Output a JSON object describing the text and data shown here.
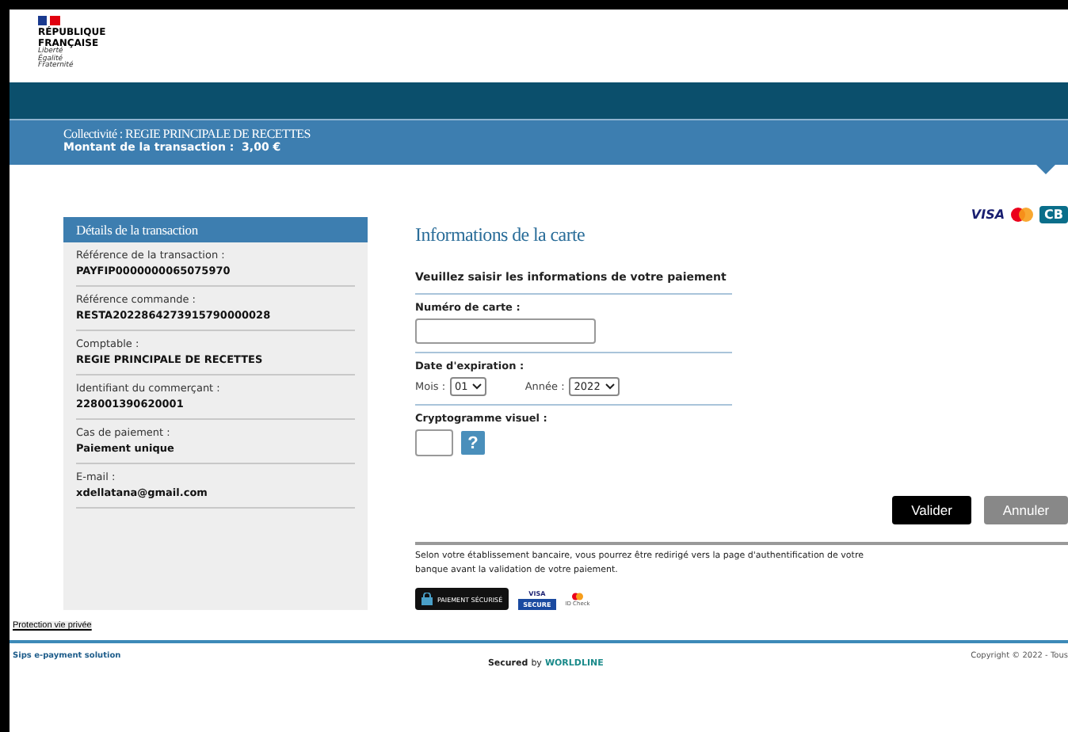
{
  "header": {
    "logo_lines": [
      "RÉPUBLIQUE",
      "FRANÇAISE"
    ],
    "motto": [
      "Liberté",
      "Égalité",
      "Fraternité"
    ]
  },
  "banner": {
    "collectivite": "Collectivité : REGIE PRINCIPALE DE RECETTES",
    "montant_label": "Montant de la transaction :",
    "montant": "3,00 €"
  },
  "details": {
    "title": "Détails de la transaction",
    "items": [
      {
        "label": "Référence de la transaction :",
        "value": "PAYFIP0000000065075970"
      },
      {
        "label": "Référence commande :",
        "value": "RESTA2022864273915790000028"
      },
      {
        "label": "Comptable :",
        "value": "REGIE PRINCIPALE DE RECETTES"
      },
      {
        "label": "Identifiant du commerçant :",
        "value": "228001390620001"
      },
      {
        "label": "Cas de paiement :",
        "value": "Paiement unique"
      },
      {
        "label": "E-mail :",
        "value": "xdellatana@gmail.com"
      }
    ]
  },
  "card_form": {
    "title": "Informations de la carte",
    "card_brands": [
      "VISA",
      "CB"
    ],
    "instruction": "Veuillez saisir les informations de votre paiement",
    "card_number_label": "Numéro de carte :",
    "expiry_label": "Date d'expiration :",
    "month_label": "Mois :",
    "month": "01",
    "year_label": "Année :",
    "year": "2022",
    "cvv_label": "Cryptogramme visuel :",
    "help_button": "?"
  },
  "buttons": [
    {
      "label": "Valider",
      "kind": "primary"
    },
    {
      "label": "Annuler",
      "kind": "secondary"
    }
  ],
  "notice": "Selon votre établissement bancaire, vous pourrez être redirigé vers la page d'authentification de votre banque avant la validation de votre paiement.",
  "badges": {
    "secure": "PAIEMENT SÉCURISÉ",
    "visa": "VISA",
    "visa_sub": "SECURE",
    "idcheck": "ID Check"
  },
  "privacy_link": "Protection vie privée",
  "footer": {
    "left": "Sips e-payment solution",
    "secured": "Secured",
    "by": "by",
    "brand": "WORLDLINE",
    "copyright": "Copyright © 2022 - Tous"
  }
}
